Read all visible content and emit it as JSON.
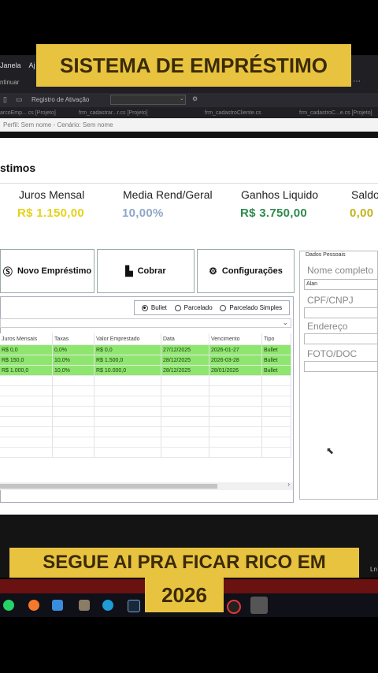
{
  "overlay": {
    "top_banner": "SISTEMA DE EMPRÉSTIMO",
    "bottom_banner_line1": "SEGUE AI PRA FICAR RICO EM",
    "bottom_banner_line2": "2026"
  },
  "ide": {
    "menu": [
      "Janela",
      "Aj"
    ],
    "toolbar_left": "ntinuar",
    "toolbar_search": "Registro de Ativação",
    "tabs": [
      "arcoEmp... cs [Projeto]",
      "frm_cadastrar...r.cs [Projeto]",
      "frm_cadastroCliente.cs",
      "frm_cadastroC...e.cs [Projeto]"
    ],
    "caption": "Perfil: Sem nome - Cenário: Sem nome"
  },
  "app": {
    "title": "stimos",
    "stats": [
      {
        "label": "Juros Mensal",
        "value": "R$ 1.150,00",
        "color": "#e6d21b"
      },
      {
        "label": "Media Rend/Geral",
        "value": "10,00%",
        "color": "#8fa7c6"
      },
      {
        "label": "Ganhos Liquido",
        "value": "R$ 3.750,00",
        "color": "#2e8a4f"
      },
      {
        "label": "Saldo",
        "value": "0,00",
        "color": "#c2b51a"
      }
    ],
    "buttons": {
      "novo": "Novo Empréstimo",
      "cobrar": "Cobrar",
      "config": "Configurações"
    },
    "radios": {
      "bullet": "Bullet",
      "parcelado": "Parcelado",
      "parcelado_simples": "Parcelado Simples"
    },
    "table": {
      "headers": [
        "Juros Mensais",
        "Taxas",
        "Valor Emprestado",
        "Data",
        "Vencimento",
        "Tipo"
      ],
      "rows": [
        [
          "R$ 0,0",
          "0,0%",
          "R$ 0,0",
          "27/12/2025",
          "2026-01-27",
          "Bullet"
        ],
        [
          "R$ 150,0",
          "10,0%",
          "R$ 1.500,0",
          "28/12/2025",
          "2026-03-28",
          "Bullet"
        ],
        [
          "R$ 1.000,0",
          "10,0%",
          "R$ 10.000,0",
          "28/12/2025",
          "28/01/2026",
          "Bullet"
        ]
      ]
    },
    "dados": {
      "group_title": "Dados Pessoais",
      "nome_label": "Nome completo",
      "nome_value": "Alan",
      "cpf_label": "CPF/CNPJ",
      "endereco_label": "Endereço",
      "foto_label": "FOTO/DOC"
    }
  },
  "taskbar": {
    "right_text": "Ln"
  }
}
